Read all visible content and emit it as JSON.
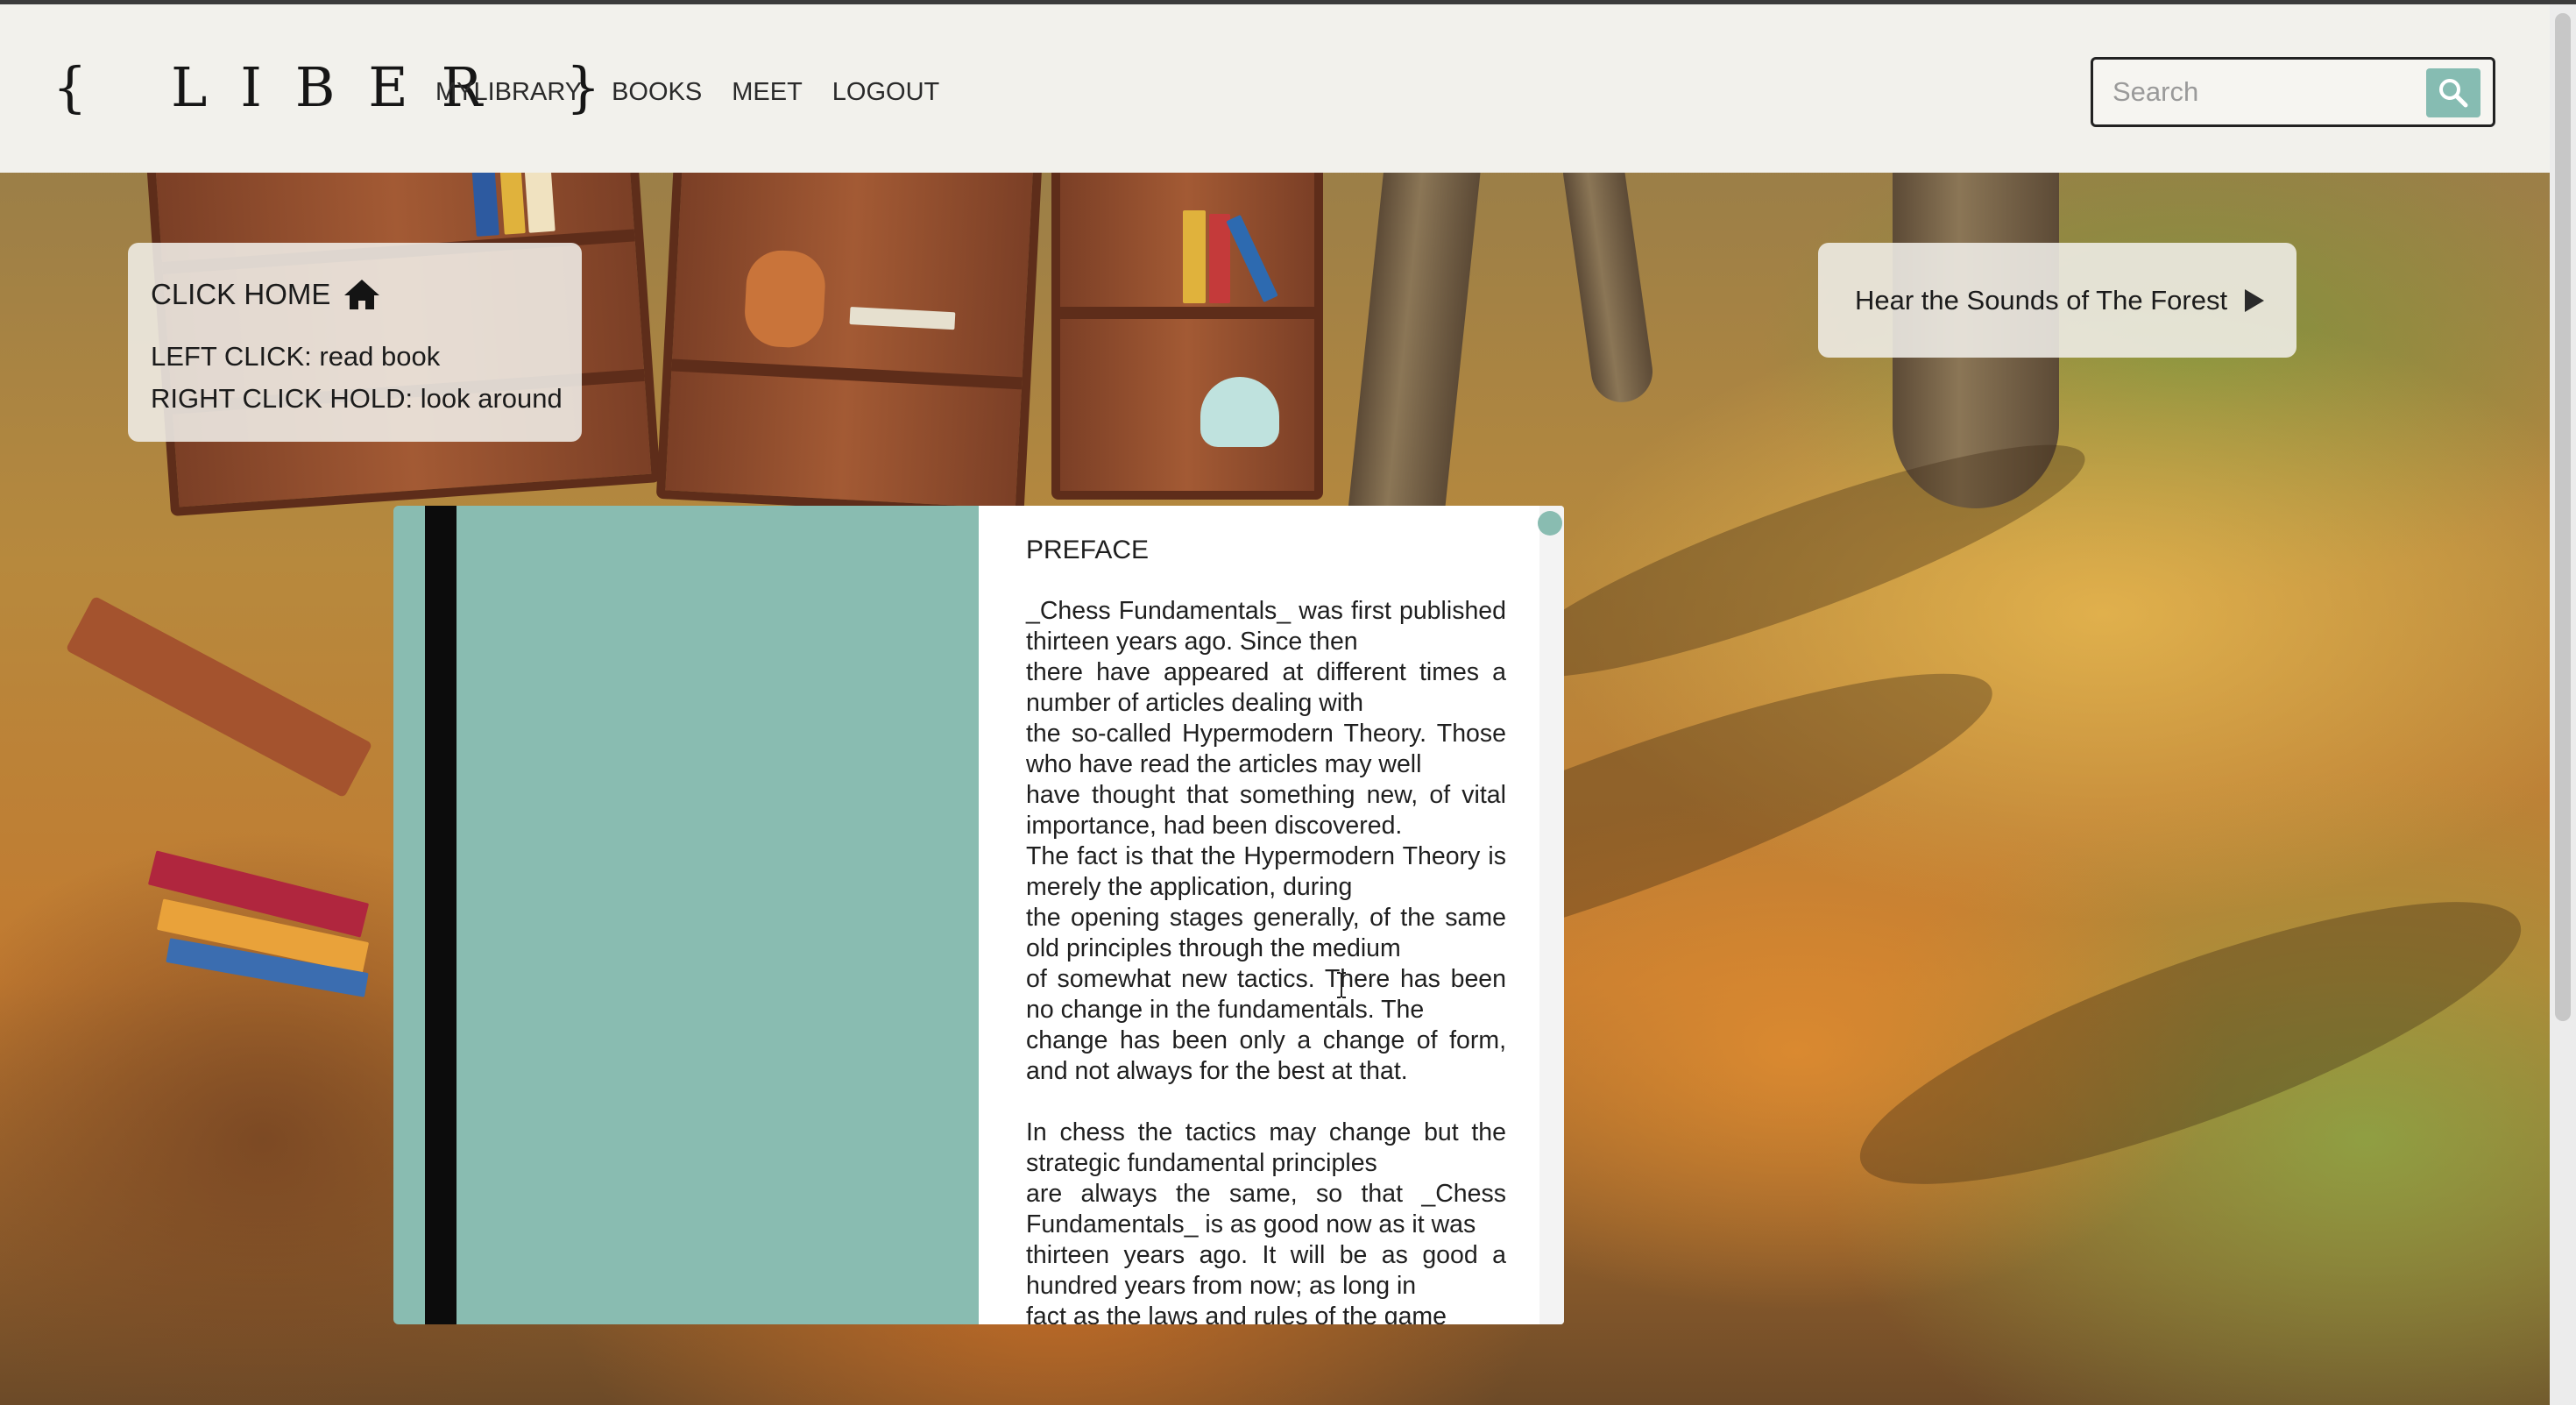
{
  "brand": {
    "logo_text": "{ LIBER }"
  },
  "nav": {
    "items": [
      {
        "label": "MYLIBRARY"
      },
      {
        "label": "BOOKS"
      },
      {
        "label": "MEET"
      },
      {
        "label": "LOGOUT"
      }
    ]
  },
  "search": {
    "placeholder": "Search",
    "value": "",
    "icon": "search-icon",
    "button_color": "#86bcb2"
  },
  "instructions": {
    "title": "CLICK HOME",
    "title_icon": "home-icon",
    "lines": [
      "LEFT CLICK: read book",
      "RIGHT CLICK HOLD: look around"
    ]
  },
  "sounds": {
    "label": "Hear the Sounds of The Forest",
    "icon": "play-icon"
  },
  "book": {
    "cover_color": "#89bcb1",
    "page_title": "PREFACE",
    "paragraphs": [
      "_Chess Fundamentals_ was first published thirteen years ago. Since then\nthere have appeared at different times a number of articles dealing with\nthe so-called Hypermodern Theory. Those who have read the articles may well\nhave thought that something new, of vital importance, had been discovered.\nThe fact is that the Hypermodern Theory is merely the application, during\nthe opening stages generally, of the same old principles through the medium\nof somewhat new tactics. There has been no change in the fundamentals. The\nchange has been only a change of form, and not always for the best at that.",
      "In chess the tactics may change but the strategic fundamental principles\nare always the same, so that _Chess Fundamentals_ is as good now as it was\nthirteen years ago. It will be as good a hundred years from now; as long in\nfact as the laws and rules of the game"
    ]
  }
}
